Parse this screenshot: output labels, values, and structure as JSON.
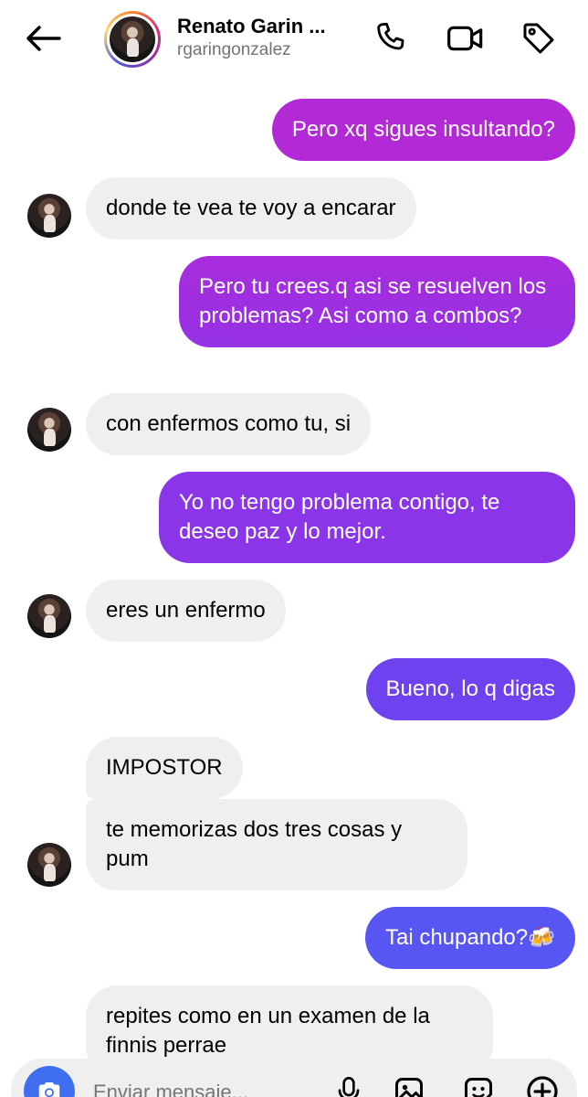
{
  "header": {
    "name": "Renato Garin ...",
    "username": "rgaringonzalez"
  },
  "messages": [
    {
      "side": "out",
      "text": "Pero xq sigues insultando?"
    },
    {
      "side": "in",
      "text": "donde te vea te voy a encarar"
    },
    {
      "side": "out",
      "text": "Pero tu crees.q asi se resuelven los problemas? Asi como a combos?"
    },
    {
      "side": "in",
      "text": "con enfermos como tu, si"
    },
    {
      "side": "out",
      "text": "Yo no tengo problema contigo, te deseo paz y lo mejor."
    },
    {
      "side": "in",
      "text": "eres un enfermo"
    },
    {
      "side": "out",
      "text": "Bueno, lo q digas"
    },
    {
      "side": "in",
      "text": "IMPOSTOR"
    },
    {
      "side": "in",
      "text": "te memorizas dos tres cosas y pum"
    },
    {
      "side": "out",
      "text": "Tai chupando?🍻"
    },
    {
      "side": "in",
      "text": "repites como en un examen de la finnis perrae"
    }
  ],
  "composer": {
    "placeholder": "Enviar mensaje..."
  },
  "icons": {
    "back": "arrow-left-icon",
    "call": "phone-icon",
    "video": "video-camera-icon",
    "tag": "tag-icon",
    "camera": "camera-icon",
    "mic": "microphone-icon",
    "gallery": "image-icon",
    "sticker": "sticker-icon",
    "add": "plus-circle-icon"
  },
  "colors": {
    "incoming_bubble": "#efefef",
    "outgoing_gradient": [
      "#b22ad6",
      "#8a35e8",
      "#6a44f0",
      "#5856f2"
    ],
    "camera_button": "#3f6ff0",
    "secondary_text": "#737373"
  }
}
